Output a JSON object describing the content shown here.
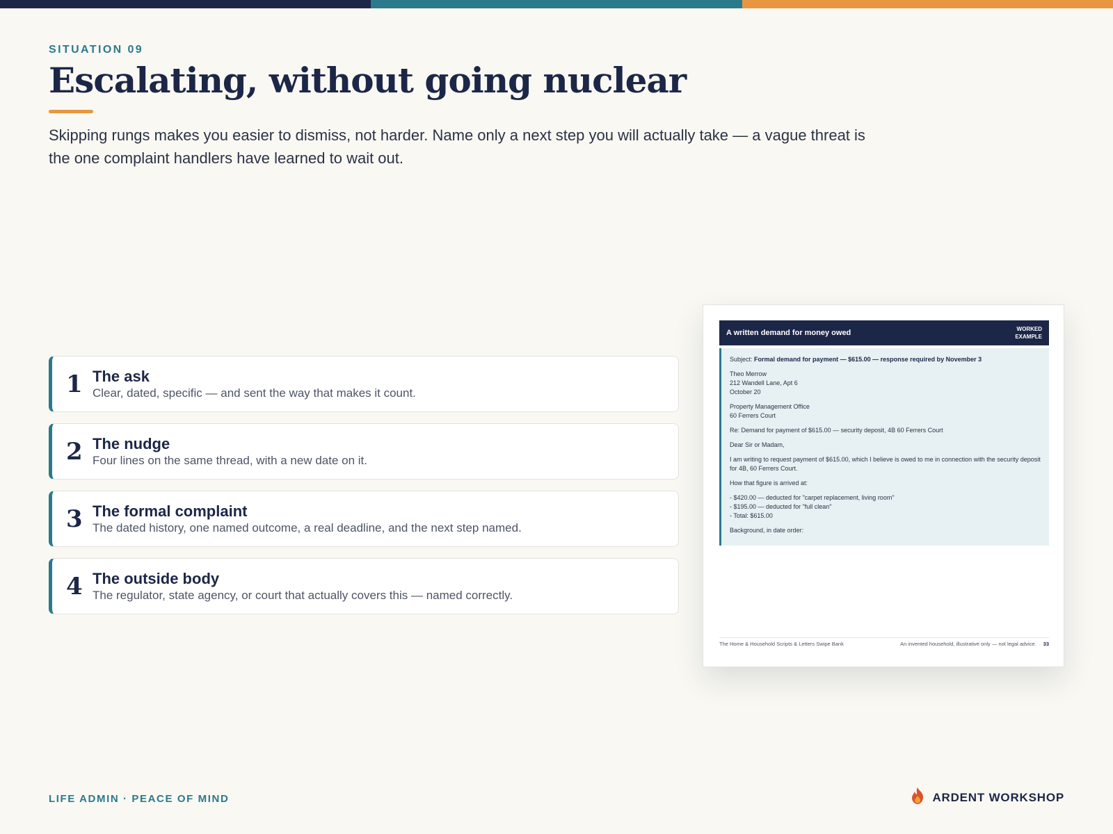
{
  "colors": {
    "navy": "#1c2747",
    "teal": "#2a7a8c",
    "orange": "#e8963f",
    "background": "#f9f8f3",
    "doc_panel": "#e7f0f2"
  },
  "header": {
    "eyebrow": "SITUATION 09",
    "title": "Escalating, without going nuclear",
    "lede": "Skipping rungs makes you easier to dismiss, not harder. Name only a next step you will actually take — a vague threat is the one complaint handlers have learned to wait out."
  },
  "steps": [
    {
      "number": "1",
      "title": "The ask",
      "description": "Clear, dated, specific — and sent the way that makes it count."
    },
    {
      "number": "2",
      "title": "The nudge",
      "description": "Four lines on the same thread, with a new date on it."
    },
    {
      "number": "3",
      "title": "The formal complaint",
      "description": "The dated history, one named outcome, a real deadline, and the next step named."
    },
    {
      "number": "4",
      "title": "The outside body",
      "description": "The regulator, state agency, or court that actually covers this — named correctly."
    }
  ],
  "document": {
    "header_title": "A written demand for money owed",
    "badge": "WORKED\nEXAMPLE",
    "subject_label": "Subject:",
    "subject_text": "Formal demand for payment — $615.00 — response required by November 3",
    "sender": [
      "Theo Merrow",
      "212 Wandell Lane, Apt 6",
      "October 20"
    ],
    "recipient": [
      "Property Management Office",
      "60 Ferrers Court"
    ],
    "re_line": "Re: Demand for payment of $615.00 — security deposit, 4B 60 Ferrers Court",
    "salutation": "Dear Sir or Madam,",
    "intro": "I am writing to request payment of $615.00, which I believe is owed to me in connection with the security deposit for 4B, 60 Ferrers Court.",
    "breakdown_label": "How that figure is arrived at:",
    "breakdown": [
      "- $420.00 — deducted for \"carpet replacement, living room\"",
      "- $195.00 — deducted for \"full clean\"",
      "- Total: $615.00"
    ],
    "background_label": "Background, in date order:",
    "footer_left": "The Home & Household Scripts & Letters Swipe Bank",
    "footer_note": "An invented household, illustrative only — not legal advice.",
    "footer_page": "33"
  },
  "footer": {
    "left": "LIFE ADMIN · PEACE OF MIND",
    "brand": "ARDENT WORKSHOP",
    "brand_icon": "flame-icon"
  }
}
